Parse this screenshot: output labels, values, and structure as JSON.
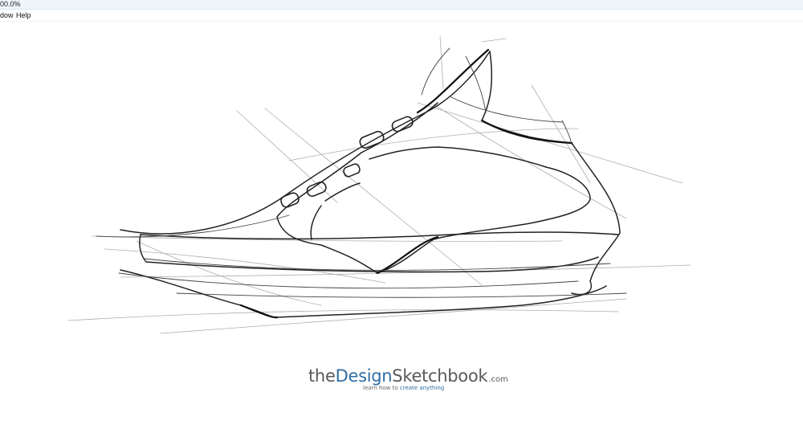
{
  "window": {
    "title": "00.0%"
  },
  "menu": {
    "items": [
      {
        "id": "window",
        "label": "dow"
      },
      {
        "id": "help",
        "label": "Help"
      }
    ]
  },
  "brand": {
    "part1": "the",
    "part2": "Design",
    "part3": "Sketchbook",
    "suffix": ".com",
    "tagline_pre": "learn how to ",
    "tagline_highlight": "create anything",
    "color_text": "#5a5a5a",
    "color_accent": "#2f6ea3"
  },
  "canvas": {
    "content": "shoe-sketch"
  }
}
